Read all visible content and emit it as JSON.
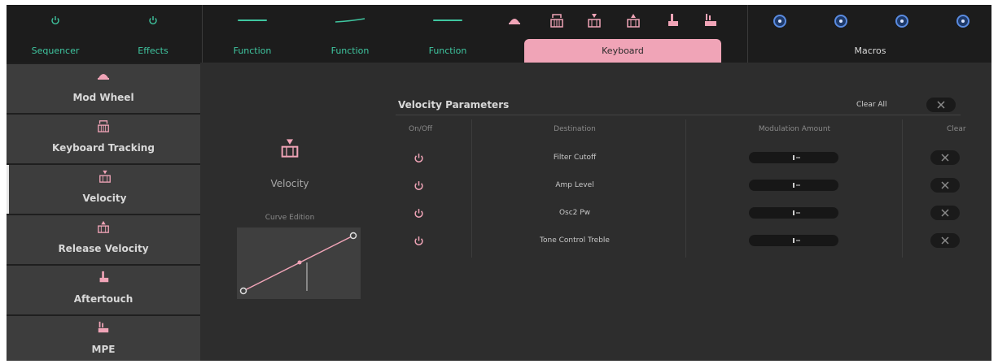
{
  "topbar": {
    "sequencer_label": "Sequencer",
    "effects_label": "Effects",
    "functions": [
      "Function",
      "Function",
      "Function"
    ],
    "keyboard_label": "Keyboard",
    "macros_label": "Macros"
  },
  "sidebar": {
    "items": [
      {
        "label": "Mod Wheel",
        "icon": "mod-wheel-icon"
      },
      {
        "label": "Keyboard Tracking",
        "icon": "keyboard-tracking-icon"
      },
      {
        "label": "Velocity",
        "icon": "velocity-icon",
        "active": true
      },
      {
        "label": "Release Velocity",
        "icon": "release-velocity-icon"
      },
      {
        "label": "Aftertouch",
        "icon": "aftertouch-icon"
      },
      {
        "label": "MPE",
        "icon": "mpe-icon"
      }
    ]
  },
  "panel": {
    "title": "Velocity",
    "curve_label": "Curve Edition"
  },
  "params": {
    "title": "Velocity Parameters",
    "clear_all_label": "Clear All",
    "columns": {
      "onoff": "On/Off",
      "destination": "Destination",
      "mod_amount": "Modulation Amount",
      "clear": "Clear"
    },
    "rows": [
      {
        "destination": "Filter Cutoff",
        "amount": 0
      },
      {
        "destination": "Amp Level",
        "amount": 0
      },
      {
        "destination": "Osc2 Pw",
        "amount": 0
      },
      {
        "destination": "Tone Control Treble",
        "amount": 0
      }
    ]
  },
  "colors": {
    "accent_pink": "#f0a4b7",
    "accent_teal": "#3fc6a0",
    "macro_blue": "#5a8be0"
  }
}
